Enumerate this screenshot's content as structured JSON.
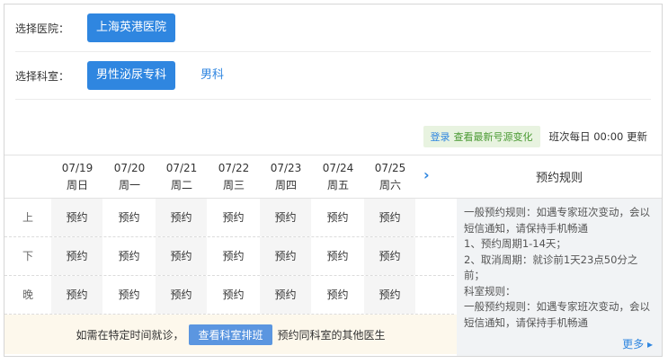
{
  "hospital": {
    "label": "选择医院：",
    "selected": "上海英港医院"
  },
  "department": {
    "label": "选择科室：",
    "selected": "男性泌尿专科",
    "other": "男科"
  },
  "update": {
    "login": "登录",
    "link_text": "查看最新号源变化",
    "note": "班次每日 00:00 更新"
  },
  "days": [
    {
      "date": "07/19",
      "weekday": "周日"
    },
    {
      "date": "07/20",
      "weekday": "周一"
    },
    {
      "date": "07/21",
      "weekday": "周二"
    },
    {
      "date": "07/22",
      "weekday": "周三"
    },
    {
      "date": "07/23",
      "weekday": "周四"
    },
    {
      "date": "07/24",
      "weekday": "周五"
    },
    {
      "date": "07/25",
      "weekday": "周六"
    }
  ],
  "next_arrow": "›",
  "periods": [
    "上",
    "下",
    "晚"
  ],
  "book_label": "预约",
  "rules": {
    "title": "预约规则",
    "lines": [
      "一般预约规则：如遇专家班次变动，会以短信通知，请保持手机畅通",
      "1、预约周期1-14天；",
      "2、取消周期：就诊前1天23点50分之前；",
      "科室规则：",
      "一般预约规则：如遇专家班次变动，会以短信通知，请保持手机畅通"
    ],
    "more": "更多 ▸"
  },
  "footer": {
    "before": "如需在特定时间就诊，",
    "button": "查看科室排班",
    "after": "预约同科室的其他医生"
  }
}
